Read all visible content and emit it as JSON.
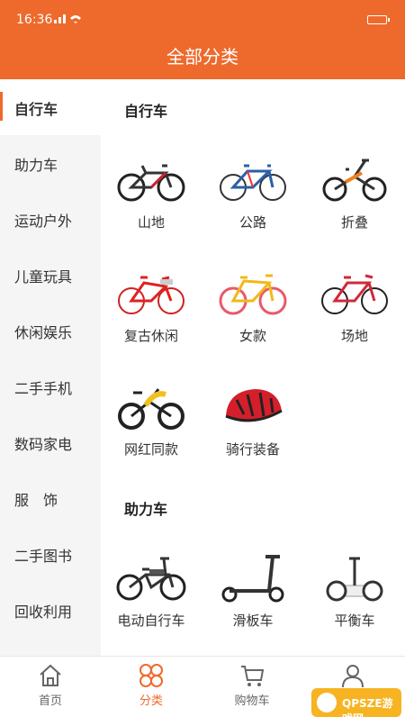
{
  "status": {
    "time": "16:36",
    "signal": "⁴⁶ıl"
  },
  "header": {
    "title": "全部分类"
  },
  "sidebar": {
    "items": [
      {
        "label": "自行车",
        "active": true
      },
      {
        "label": "助力车"
      },
      {
        "label": "运动户外"
      },
      {
        "label": "儿童玩具"
      },
      {
        "label": "休闲娱乐"
      },
      {
        "label": "二手手机"
      },
      {
        "label": "数码家电"
      },
      {
        "label": "服　饰"
      },
      {
        "label": "二手图书"
      },
      {
        "label": "回收利用"
      }
    ]
  },
  "sections": [
    {
      "title": "自行车",
      "tiles": [
        {
          "label": "山地",
          "icon": "mountain-bike-icon"
        },
        {
          "label": "公路",
          "icon": "road-bike-icon"
        },
        {
          "label": "折叠",
          "icon": "folding-bike-icon"
        },
        {
          "label": "复古休闲",
          "icon": "retro-bike-icon"
        },
        {
          "label": "女款",
          "icon": "women-bike-icon"
        },
        {
          "label": "场地",
          "icon": "track-bike-icon"
        },
        {
          "label": "网红同款",
          "icon": "trendy-bike-icon"
        },
        {
          "label": "骑行装备",
          "icon": "helmet-icon"
        }
      ]
    },
    {
      "title": "助力车",
      "tiles": [
        {
          "label": "电动自行车",
          "icon": "ebike-icon"
        },
        {
          "label": "滑板车",
          "icon": "scooter-icon"
        },
        {
          "label": "平衡车",
          "icon": "balance-car-icon"
        }
      ]
    }
  ],
  "tabbar": {
    "items": [
      {
        "label": "首页",
        "icon": "home-icon"
      },
      {
        "label": "分类",
        "icon": "category-icon",
        "active": true
      },
      {
        "label": "购物车",
        "icon": "cart-icon"
      },
      {
        "label": "我的",
        "icon": "profile-icon"
      }
    ]
  },
  "watermark": {
    "text": "QPSZE游戏网"
  },
  "colors": {
    "accent": "#ee6a2c",
    "sidebar_bg": "#f5f5f5"
  }
}
